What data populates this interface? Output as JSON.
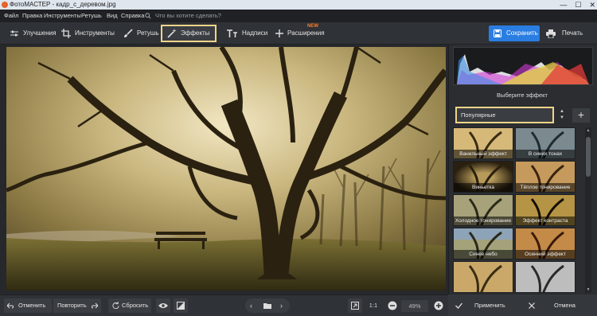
{
  "window": {
    "title": "ФотоМАСТЕР - кадр_с_деревом.jpg",
    "controls": [
      "—",
      "☐",
      "✕"
    ]
  },
  "menu": {
    "items": [
      "Файл",
      "Правка",
      "Инструменты",
      "Ретушь",
      "Вид",
      "Справка"
    ],
    "search_placeholder": "Что вы хотите сделать?"
  },
  "toolbar": {
    "tabs": [
      {
        "label": "Улучшения",
        "icon": "sliders-icon"
      },
      {
        "label": "Инструменты",
        "icon": "crop-icon"
      },
      {
        "label": "Ретушь",
        "icon": "brush-icon"
      },
      {
        "label": "Эффекты",
        "icon": "magic-wand-icon",
        "active": true
      },
      {
        "label": "Надписи",
        "icon": "text-icon"
      },
      {
        "label": "Расширения",
        "icon": "plus-icon",
        "badge": "NEW"
      }
    ],
    "save_label": "Сохранить",
    "print_label": "Печать"
  },
  "effects_panel": {
    "title": "Выберите эффект",
    "category_selected": "Популярные",
    "add_label": "+",
    "effects": [
      "Ванильный эффект",
      "В синих тонах",
      "Виньетка",
      "Тёплое тонирование",
      "Холодное тонирование",
      "Эффект контраста",
      "Синее небо",
      "Осенний эффект",
      "",
      ""
    ]
  },
  "bottom": {
    "undo_label": "Отменить",
    "redo_label": "Повторить",
    "reset_label": "Сбросить",
    "ratio_label": "1:1",
    "zoom_value": "49%",
    "apply_label": "Применить",
    "cancel_label": "Отмена"
  },
  "colors": {
    "accent_blue": "#2a7de1",
    "active_outline": "#f0d58a",
    "new_badge": "#ff7b2a"
  }
}
